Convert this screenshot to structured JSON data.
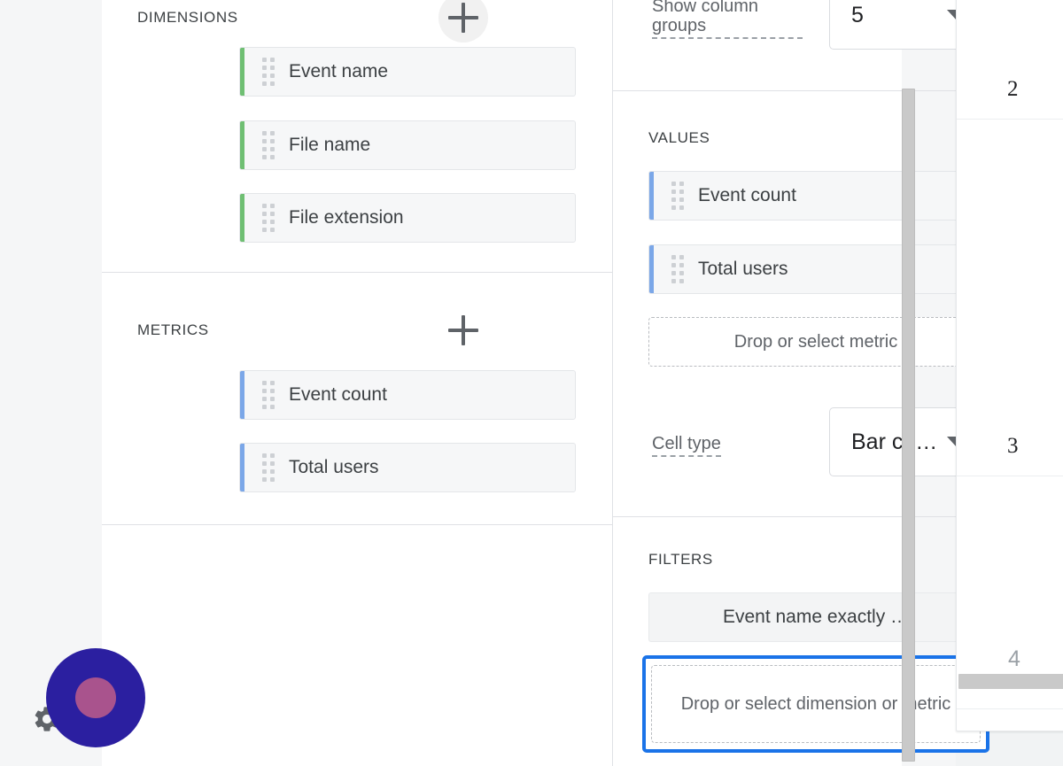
{
  "colors": {
    "dimension_accent": "#6fbf73",
    "metric_accent": "#7ba7e8",
    "focus_ring": "#1a73e8",
    "cursor_outer": "#2b1fa0",
    "cursor_inner": "#a9538d",
    "panel_bg": "#ffffff",
    "page_bg": "#f5f6f7"
  },
  "left_column": {
    "dimensions": {
      "title": "DIMENSIONS",
      "add_label": "+",
      "chips": [
        {
          "label": "Event name"
        },
        {
          "label": "File name"
        },
        {
          "label": "File extension"
        }
      ]
    },
    "metrics": {
      "title": "METRICS",
      "add_label": "+",
      "chips": [
        {
          "label": "Event count"
        },
        {
          "label": "Total users"
        }
      ]
    }
  },
  "middle_column": {
    "show_column_groups": {
      "label": "Show column groups",
      "value": "5"
    },
    "values": {
      "title": "VALUES",
      "chips": [
        {
          "label": "Event count"
        },
        {
          "label": "Total users"
        }
      ],
      "dropzone": "Drop or select metric"
    },
    "cell_type": {
      "label": "Cell type",
      "value": "Bar ch…"
    },
    "filters": {
      "title": "FILTERS",
      "chips": [
        {
          "label": "Event name exactly …"
        }
      ],
      "dropzone": "Drop or select dimension or metric"
    }
  },
  "table_preview": {
    "cells": [
      {
        "value": "2",
        "muted": false
      },
      {
        "value": "3",
        "muted": false
      },
      {
        "value": "4",
        "muted": true
      }
    ]
  },
  "icons": {
    "drag_handle": "drag-handle-icon",
    "caret": "chevron-down-icon",
    "gear": "gear-icon",
    "cursor": "cursor-click-indicator"
  }
}
